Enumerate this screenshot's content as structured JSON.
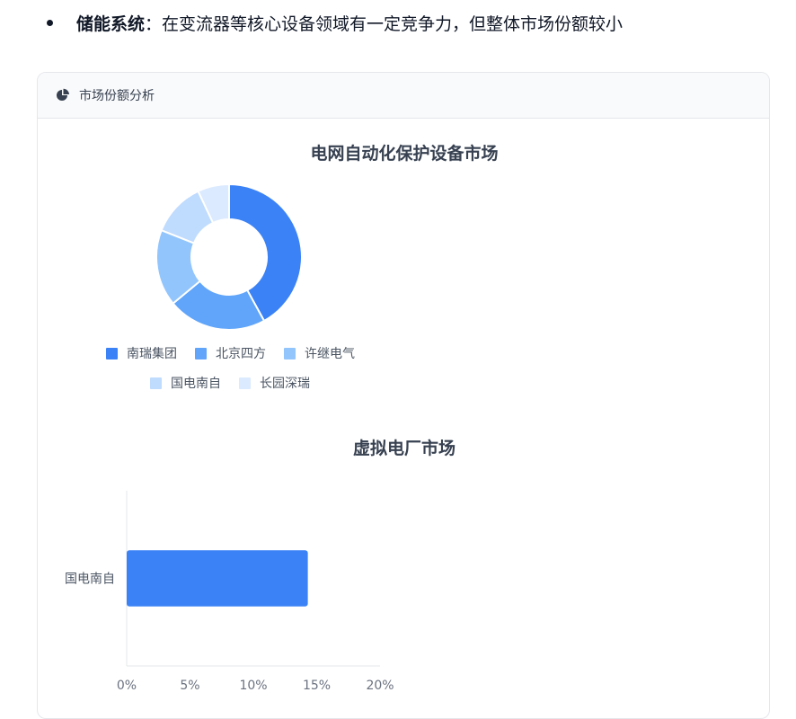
{
  "bullet": {
    "term": "储能系统",
    "text": "：在变流器等核心设备领域有一定竞争力，但整体市场份额较小"
  },
  "card": {
    "header_title": "市场份额分析",
    "header_icon": "pie-chart-icon"
  },
  "chart_data": [
    {
      "type": "pie",
      "title": "电网自动化保护设备市场",
      "categories": [
        "南瑞集团",
        "北京四方",
        "许继电气",
        "国电南自",
        "长园深瑞"
      ],
      "values": [
        42,
        22,
        17,
        12,
        7
      ],
      "colors": [
        "#3b82f6",
        "#60a5fa",
        "#93c5fd",
        "#bfdbfe",
        "#dbeafe"
      ],
      "donut": true,
      "legend_position": "bottom"
    },
    {
      "type": "bar",
      "orientation": "horizontal",
      "title": "虚拟电厂市场",
      "categories": [
        "国电南自"
      ],
      "values": [
        14.3
      ],
      "xlim": [
        0,
        20
      ],
      "xticks": [
        "0%",
        "5%",
        "10%",
        "15%",
        "20%"
      ],
      "colors": [
        "#3b82f6"
      ]
    }
  ]
}
